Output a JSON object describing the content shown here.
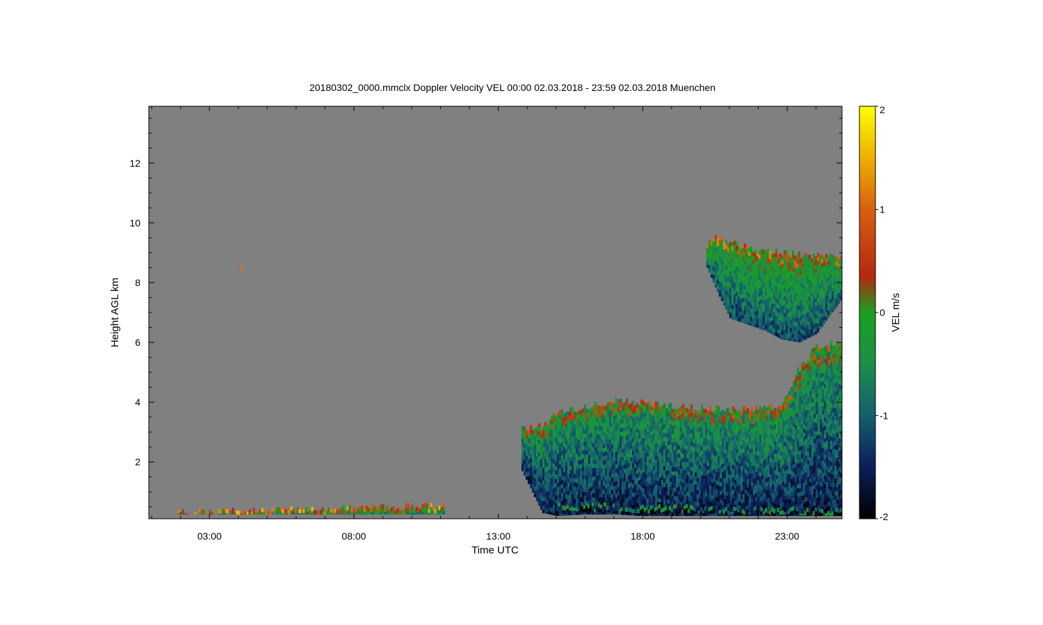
{
  "chart_data": {
    "type": "heatmap",
    "title": "20180302_0000.mmclx Doppler Velocity VEL   00:00 02.03.2018 - 23:59 02.03.2018 Muenchen",
    "xlabel": "Time UTC",
    "ylabel": "Height AGL km",
    "x_unit": "hours UTC",
    "xlim": [
      0.9,
      24.9
    ],
    "ylim": [
      0.1,
      13.9
    ],
    "x_ticks": [
      {
        "value": 3,
        "label": "03:00"
      },
      {
        "value": 8,
        "label": "08:00"
      },
      {
        "value": 13,
        "label": "13:00"
      },
      {
        "value": 18,
        "label": "18:00"
      },
      {
        "value": 23,
        "label": "23:00"
      }
    ],
    "y_ticks": [
      {
        "value": 2,
        "label": "2"
      },
      {
        "value": 4,
        "label": "4"
      },
      {
        "value": 6,
        "label": "6"
      },
      {
        "value": 8,
        "label": "8"
      },
      {
        "value": 10,
        "label": "10"
      },
      {
        "value": 12,
        "label": "12"
      }
    ],
    "background_color": "#808080",
    "colorbar": {
      "label": "VEL m/s",
      "range": [
        -2,
        2
      ],
      "ticks": [
        {
          "value": 2,
          "label": "2"
        },
        {
          "value": 1,
          "label": "1"
        },
        {
          "value": 0,
          "label": "0"
        },
        {
          "value": -1,
          "label": "-1"
        },
        {
          "value": -2,
          "label": "-2"
        }
      ],
      "stops": [
        {
          "value": -2.0,
          "color": "#000000"
        },
        {
          "value": -1.5,
          "color": "#0c1e5a"
        },
        {
          "value": -1.0,
          "color": "#145f6e"
        },
        {
          "value": -0.5,
          "color": "#1b8f4a"
        },
        {
          "value": 0.0,
          "color": "#1aa01e"
        },
        {
          "value": 0.35,
          "color": "#b42810"
        },
        {
          "value": 1.0,
          "color": "#d86010"
        },
        {
          "value": 1.6,
          "color": "#f0c000"
        },
        {
          "value": 2.0,
          "color": "#ffff00"
        }
      ]
    },
    "echo_regions": [
      {
        "name": "low-morning-layer",
        "vel": -0.3,
        "x": [
          1.9,
          11.1
        ],
        "bottom": [
          0.25,
          0.25
        ],
        "top": [
          0.3,
          0.55
        ]
      },
      {
        "name": "isolated-pixel",
        "vel": -0.4,
        "x": [
          4.0,
          4.1
        ],
        "bottom": [
          8.45,
          8.45
        ],
        "top": [
          8.6,
          8.6
        ]
      },
      {
        "name": "afternoon-main-cloud",
        "vel": -1.0,
        "x": [
          13.8,
          14.5,
          15.0,
          16.0,
          17.0,
          17.8,
          19.0,
          20.0,
          21.0,
          22.0,
          22.8,
          23.3,
          23.7,
          24.0,
          24.9
        ],
        "bottom": [
          1.7,
          0.3,
          0.2,
          0.25,
          0.25,
          0.2,
          0.2,
          0.2,
          0.2,
          0.2,
          0.2,
          0.2,
          0.2,
          0.2,
          0.2
        ],
        "top": [
          3.1,
          3.2,
          3.6,
          3.85,
          4.05,
          4.0,
          3.85,
          3.8,
          3.75,
          3.8,
          3.9,
          5.0,
          5.5,
          5.9,
          6.0
        ]
      },
      {
        "name": "upper-cloud",
        "vel": -0.6,
        "x": [
          20.2,
          20.6,
          21.0,
          21.6,
          22.2,
          22.8,
          23.4,
          24.0,
          24.9
        ],
        "bottom": [
          8.5,
          7.6,
          6.8,
          6.6,
          6.4,
          6.1,
          6.0,
          6.3,
          7.5
        ],
        "top": [
          9.4,
          9.5,
          9.4,
          9.2,
          9.05,
          9.0,
          8.95,
          8.9,
          8.9
        ]
      },
      {
        "name": "boundary-layer-top",
        "vel": -1.8,
        "x": [
          15.0,
          16.0,
          17.0,
          18.0,
          19.0,
          20.0,
          21.0,
          22.0,
          23.0,
          24.0,
          24.9
        ],
        "bottom": [
          0.4,
          0.35,
          0.3,
          0.25,
          0.3,
          0.3,
          0.25,
          0.25,
          0.25,
          0.2,
          0.2
        ],
        "top": [
          0.55,
          0.55,
          0.52,
          0.48,
          0.5,
          0.46,
          0.44,
          0.4,
          0.4,
          0.36,
          0.36
        ]
      }
    ]
  }
}
